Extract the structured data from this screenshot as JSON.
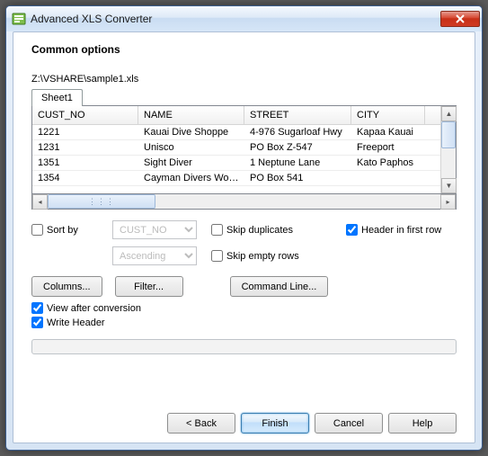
{
  "window": {
    "title": "Advanced XLS Converter"
  },
  "heading": "Common options",
  "filepath": "Z:\\VSHARE\\sample1.xls",
  "tabs": [
    "Sheet1"
  ],
  "columns": [
    "CUST_NO",
    "NAME",
    "STREET",
    "CITY"
  ],
  "rows": [
    {
      "cust_no": "1221",
      "name": "Kauai Dive Shoppe",
      "street": "4-976 Sugarloaf Hwy",
      "city": "Kapaa Kauai"
    },
    {
      "cust_no": "1231",
      "name": "Unisco",
      "street": "PO Box Z-547",
      "city": "Freeport"
    },
    {
      "cust_no": "1351",
      "name": "Sight Diver",
      "street": "1 Neptune Lane",
      "city": "Kato Paphos"
    },
    {
      "cust_no": "1354",
      "name": "Cayman Divers Worl...",
      "street": "PO Box 541",
      "city": ""
    }
  ],
  "options": {
    "sort_by": {
      "label": "Sort by",
      "checked": false,
      "field": "CUST_NO",
      "order": "Ascending"
    },
    "skip_duplicates": {
      "label": "Skip duplicates",
      "checked": false
    },
    "skip_empty_rows": {
      "label": "Skip empty rows",
      "checked": false
    },
    "header_first_row": {
      "label": "Header in first row",
      "checked": true
    },
    "view_after": {
      "label": "View after conversion",
      "checked": true
    },
    "write_header": {
      "label": "Write Header",
      "checked": true
    }
  },
  "buttons": {
    "columns": "Columns...",
    "filter": "Filter...",
    "command_line": "Command Line...",
    "back": "< Back",
    "finish": "Finish",
    "cancel": "Cancel",
    "help": "Help"
  }
}
